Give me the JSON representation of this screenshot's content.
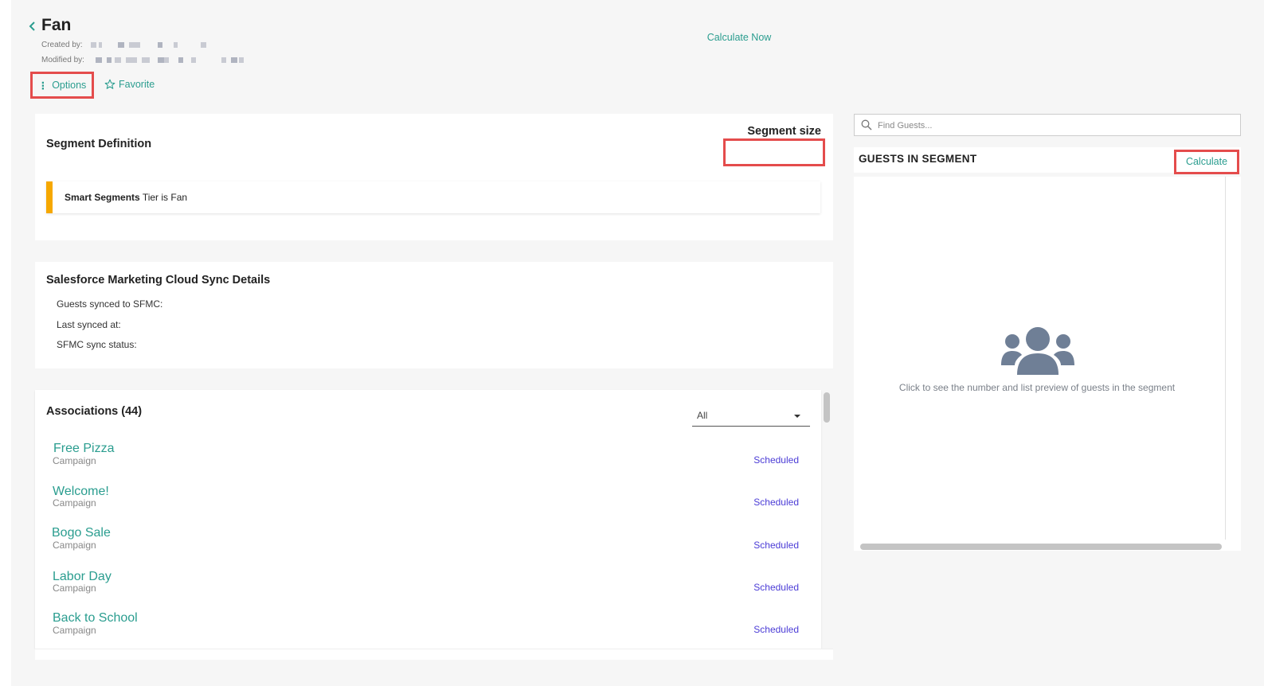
{
  "header": {
    "title": "Fan",
    "created_label": "Created by:",
    "modified_label": "Modified by:",
    "options_label": "Options",
    "favorite_label": "Favorite"
  },
  "segment_definition": {
    "title": "Segment Definition",
    "segment_size_label": "Segment size",
    "calculate_now_label": "Calculate Now",
    "rule_bold": "Smart Segments",
    "rule_text": "Tier is Fan"
  },
  "sfmc": {
    "title": "Salesforce Marketing Cloud Sync Details",
    "rows": [
      "Guests synced to SFMC:",
      "Last synced at:",
      "SFMC sync status:"
    ]
  },
  "associations": {
    "title": "Associations (44)",
    "filter_value": "All",
    "items": [
      {
        "name": "Free Pizza",
        "type": "Campaign",
        "status": "Scheduled"
      },
      {
        "name": "Welcome!",
        "type": "Campaign",
        "status": "Scheduled"
      },
      {
        "name": "Bogo Sale",
        "type": "Campaign",
        "status": "Scheduled"
      },
      {
        "name": "Labor Day",
        "type": "Campaign",
        "status": "Scheduled"
      },
      {
        "name": "Back to School",
        "type": "Campaign",
        "status": "Scheduled"
      }
    ]
  },
  "guests": {
    "search_placeholder": "Find Guests...",
    "title": "GUESTS IN SEGMENT",
    "calculate_label": "Calculate",
    "empty_hint": "Click to see the number and list preview of guests in the segment",
    "people_icon": "users-group-icon"
  },
  "colors": {
    "accent": "#2a9d8f",
    "highlight": "#e44c4c",
    "rule_bar": "#f6a800",
    "status": "#4b3cd6"
  }
}
